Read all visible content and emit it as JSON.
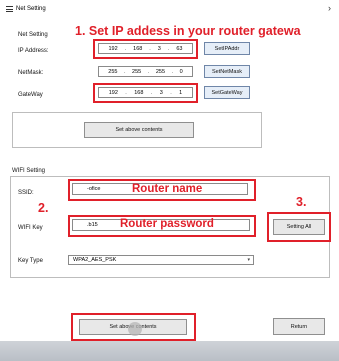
{
  "window": {
    "title": "Net Setting"
  },
  "annotations": {
    "step1": "1. Set IP addess in  your router gatewa",
    "step2": "2.",
    "step3": "3.",
    "router_name": "Router name",
    "router_password": "Router password"
  },
  "net": {
    "section_label": "Net Setting",
    "ip": {
      "label": "IP Address:",
      "o1": "192",
      "o2": "168",
      "o3": "3",
      "o4": "63",
      "button": "SetIPAddr"
    },
    "mask": {
      "label": "NetMask:",
      "o1": "255",
      "o2": "255",
      "o3": "255",
      "o4": "0",
      "button": "SetNetMask"
    },
    "gateway": {
      "label": "GateWay",
      "o1": "192",
      "o2": "168",
      "o3": "3",
      "o4": "1",
      "button": "SetGateWay"
    },
    "set_button": "Set above contents"
  },
  "wifi": {
    "section_label": "WIFI Setting",
    "ssid_label": "SSID:",
    "ssid_value": "-ofice",
    "key_label": "WIFI Key",
    "key_value": ".b15",
    "keytype_label": "Key Type",
    "keytype_value": "WPA2_AES_PSK",
    "setting_all_button": "Setting All",
    "set_button": "Set above contents",
    "return_button": "Return"
  },
  "colors": {
    "annotation": "#e0202a",
    "button_bg": "#e8e8e8",
    "blue_button_bg": "#e6eef8"
  }
}
